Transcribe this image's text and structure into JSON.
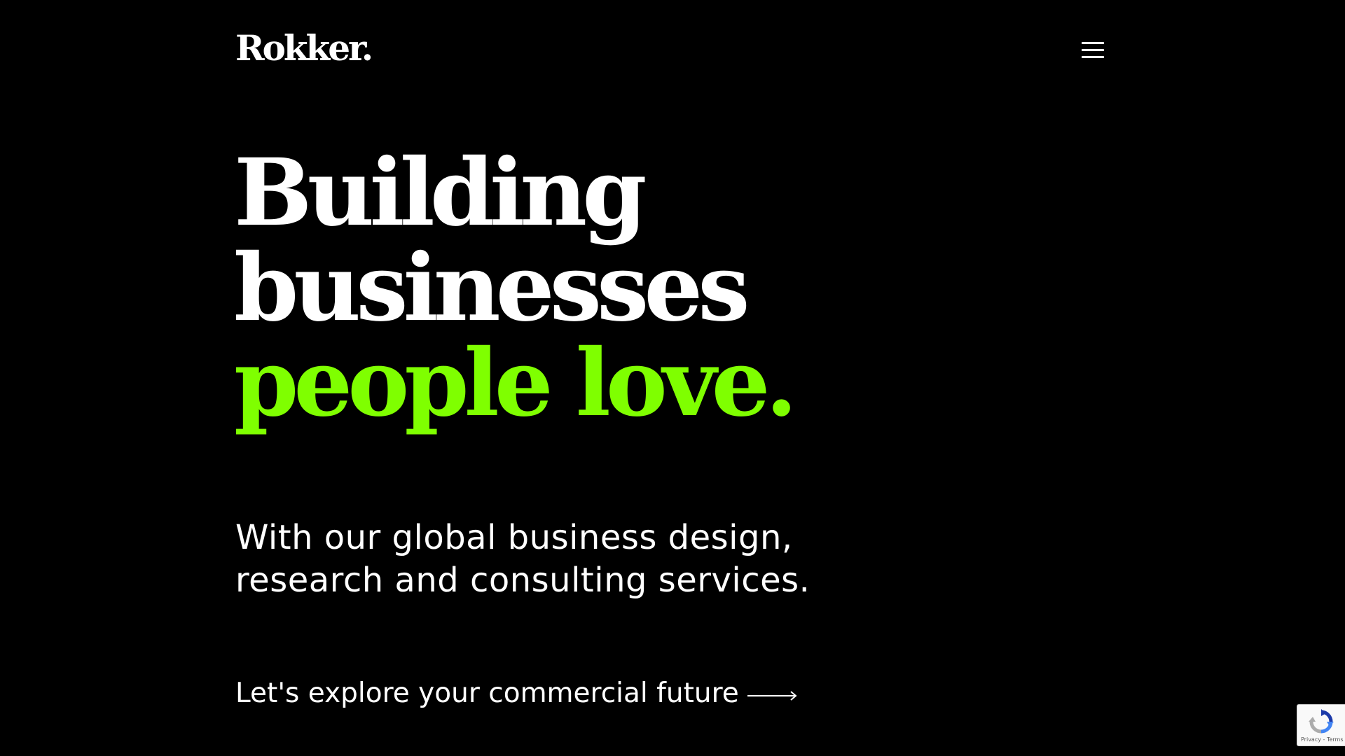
{
  "header": {
    "logo_text": "Rokker.",
    "menu_icon": "hamburger-menu-icon"
  },
  "hero": {
    "headline_line1": "Building",
    "headline_line2": "businesses",
    "headline_line3": "people love.",
    "subtitle_line1": "With our global business design,",
    "subtitle_line2": "research and consulting services.",
    "cta_text": "Let's explore your commercial future",
    "cta_icon": "long-arrow-right-icon"
  },
  "recaptcha": {
    "terms_text": "Privacy - Terms",
    "icon": "recaptcha-icon"
  },
  "colors": {
    "background": "#000000",
    "text": "#ffffff",
    "accent": "#7fff00"
  }
}
